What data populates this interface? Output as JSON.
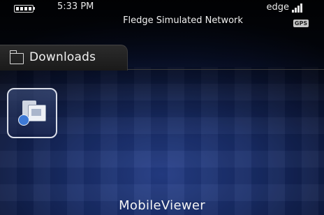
{
  "status_bar": {
    "time": "5:33 PM",
    "network_name": "Fledge Simulated Network",
    "carrier": "edge",
    "gps_badge": "GPS"
  },
  "folder": {
    "title": "Downloads"
  },
  "apps": [
    {
      "label": "MobileViewer",
      "icon": "mobile-viewer-icon",
      "selected": true
    }
  ],
  "colors": {
    "background_top": "#000000",
    "background_glow": "#263f8a",
    "text": "#ffffff"
  }
}
